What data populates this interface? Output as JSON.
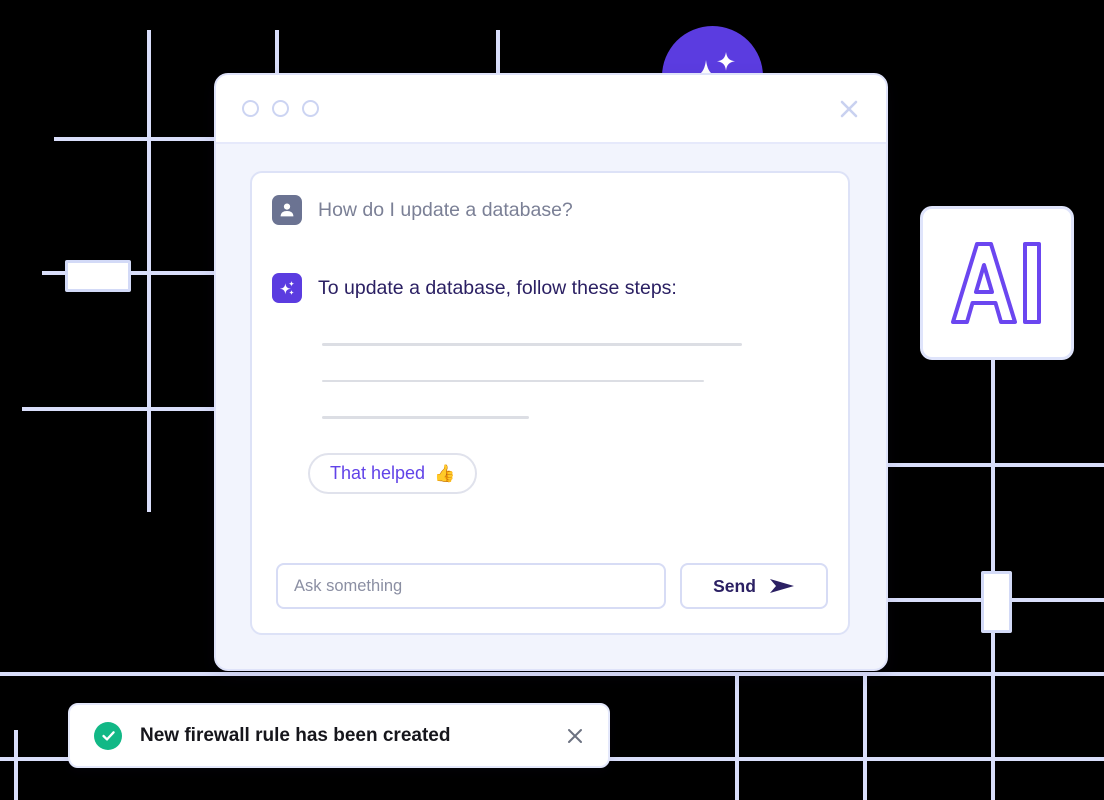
{
  "theme": {
    "background": "#000000",
    "grid_line": "#d9defa",
    "accent_purple": "#5b3ce0",
    "link_purple": "#6143e8",
    "dark_text": "#2b2063",
    "muted_text": "#7b8096",
    "success_green": "#12b886",
    "window_bg": "#f2f4fd",
    "panel_bg": "#ffffff",
    "border": "#dfe3fa"
  },
  "badges": {
    "ai_label": "AI",
    "ai_icon": "ai-outline-letters",
    "sparkle_icon": "sparkles-icon"
  },
  "window": {
    "titlebar": {
      "traffic_lights": [
        "dot-1",
        "dot-2",
        "dot-3"
      ],
      "close_icon": "close-icon"
    },
    "messages": [
      {
        "role": "user",
        "avatar_icon": "person-icon",
        "text": "How do I update a database?"
      },
      {
        "role": "assistant",
        "avatar_icon": "sparkles-icon",
        "text": "To update a database, follow these steps:"
      }
    ],
    "skeleton_lines": [
      420,
      382,
      207
    ],
    "feedback_button": {
      "label": "That helped",
      "emoji": "👍",
      "emoji_name": "thumbs-up-emoji"
    },
    "composer": {
      "input_value": "",
      "input_placeholder": "Ask something",
      "send_label": "Send",
      "send_icon": "paper-plane-icon"
    }
  },
  "toast": {
    "status_icon": "check-circle-icon",
    "message": "New firewall rule has been created",
    "close_icon": "close-icon"
  }
}
